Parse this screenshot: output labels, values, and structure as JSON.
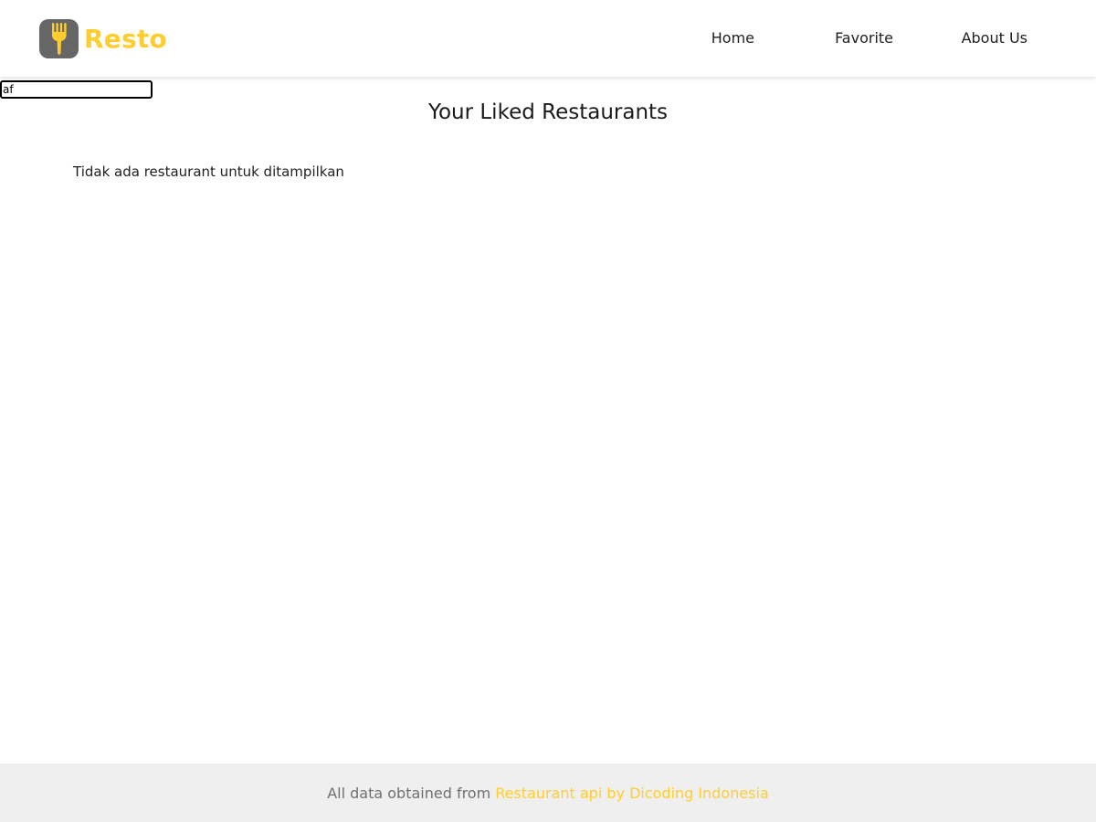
{
  "colors": {
    "brand_accent": "#FFCE2E",
    "logo_background": "#666666",
    "footer_background": "#EFEFEF",
    "footer_text": "#707070"
  },
  "header": {
    "brand": {
      "icon": "fork-icon",
      "name": "Resto"
    },
    "nav": {
      "home": "Home",
      "favorite": "Favorite",
      "about": "About Us"
    }
  },
  "debug_input": {
    "value": "af"
  },
  "main": {
    "title": "Your Liked Restaurants",
    "empty_message": "Tidak ada restaurant untuk ditampilkan"
  },
  "footer": {
    "text": "All data obtained from",
    "link_label": "Restaurant api by Dicoding Indonesia"
  }
}
